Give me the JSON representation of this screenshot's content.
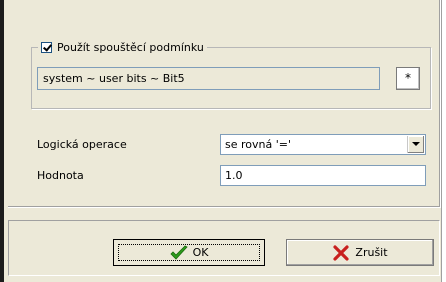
{
  "trigger_group": {
    "enabled_checkbox_label": "Použít spouštěcí podmínku",
    "enabled": true,
    "condition_path": "system ~ user bits ~ Bit5",
    "browse_button_label": "*"
  },
  "form": {
    "logical_operation_label": "Logická operace",
    "logical_operation_value": "se rovná '='",
    "value_label": "Hodnota",
    "value": "1.0"
  },
  "buttons": {
    "ok_label": "OK",
    "cancel_label": "Zrušit"
  },
  "icons": {
    "ok": "checkmark-icon",
    "cancel": "red-x-icon"
  },
  "colors": {
    "checkmark": "#2e9c1c",
    "cancel_x": "#c8201e"
  }
}
